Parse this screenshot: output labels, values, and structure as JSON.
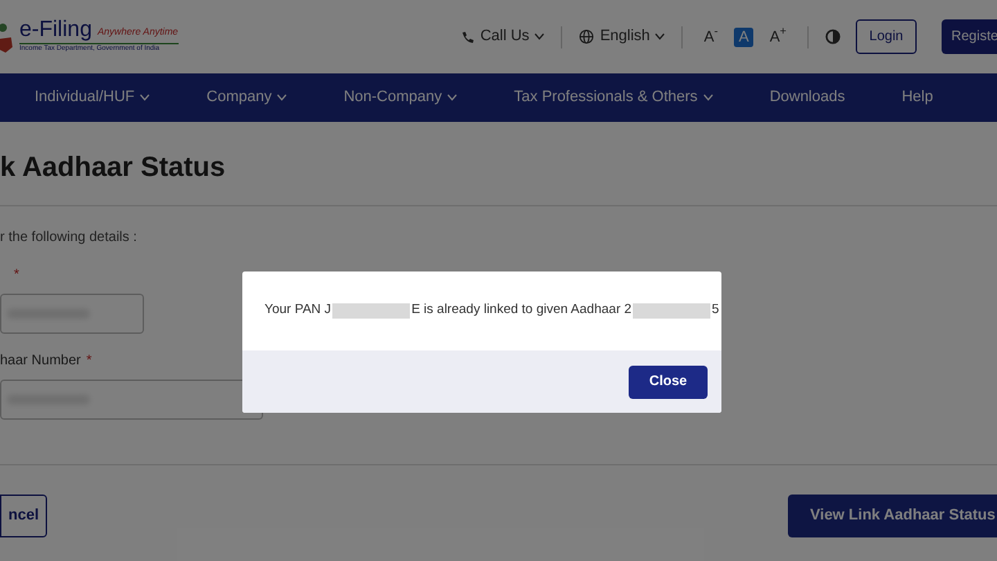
{
  "header": {
    "logo": {
      "title": "e-Filing",
      "tagline": "Anywhere Anytime",
      "subtitle": "Income Tax Department, Government of India"
    },
    "call_us": "Call Us",
    "language": "English",
    "font_controls": [
      {
        "label": "A$^{-}$",
        "selected": false
      },
      {
        "label": "A",
        "selected": true
      },
      {
        "label": "A$^{+}$",
        "selected": false
      }
    ],
    "login": "Login",
    "register": "Registe"
  },
  "nav": [
    {
      "label": "Individual/HUF",
      "dropdown": true
    },
    {
      "label": "Company",
      "dropdown": true
    },
    {
      "label": "Non-Company",
      "dropdown": true
    },
    {
      "label": "Tax Professionals & Others",
      "dropdown": true
    },
    {
      "label": "Downloads",
      "dropdown": false
    },
    {
      "label": "Help",
      "dropdown": false
    }
  ],
  "page": {
    "title": "k Aadhaar Status",
    "instruction": "r the following details :",
    "fields": [
      {
        "required_mark": "*"
      },
      {
        "label": "haar Number",
        "required_mark": "*"
      }
    ],
    "cancel": "ncel",
    "view_status": "View Link Aadhaar Status"
  },
  "modal": {
    "message": [
      {
        "kind": "text",
        "text": "Your PAN J"
      },
      {
        "kind": "redaction"
      },
      {
        "kind": "text",
        "text": "E is already linked to given Aadhaar 2"
      },
      {
        "kind": "redaction"
      },
      {
        "kind": "text",
        "text": "5"
      }
    ],
    "close": "Close"
  }
}
